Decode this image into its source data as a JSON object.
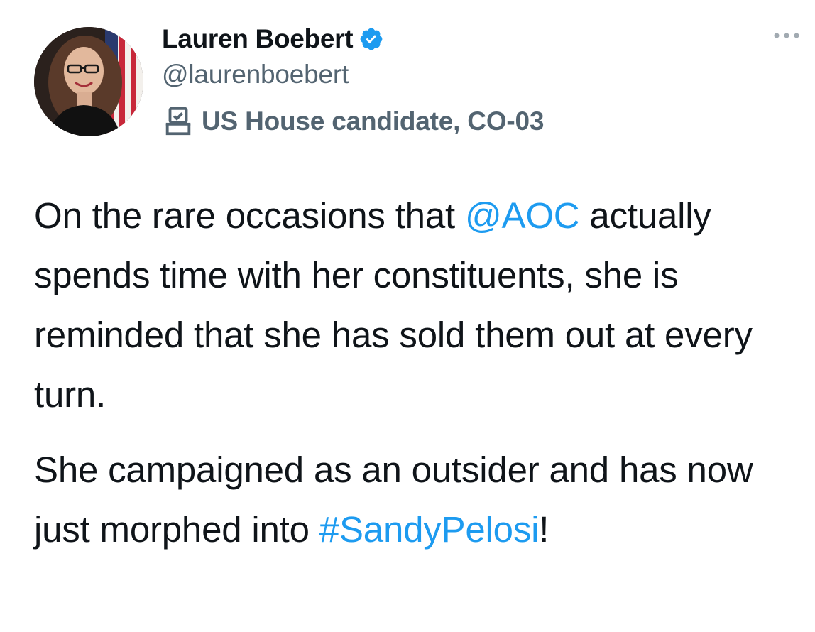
{
  "author": {
    "display_name": "Lauren Boebert",
    "handle": "@laurenboebert",
    "label": "US House candidate, CO-03",
    "verified_icon": "verified-badge-icon",
    "label_icon": "ballot-box-icon"
  },
  "tweet": {
    "paragraph1": {
      "before_mention": "On the rare occasions that ",
      "mention": "@AOC",
      "after_mention": " actually spends time with her constituents, she is reminded that she has sold them out at every turn."
    },
    "paragraph2": {
      "text": "She campaigned as an outsider and has now just morphed into ",
      "hashtag": "#SandyPelosi",
      "after_hashtag": "!"
    }
  },
  "menu": {
    "more_icon": "more-dots-icon"
  },
  "colors": {
    "link": "#1d9bf0",
    "text": "#0f1419",
    "secondary": "#536471",
    "verified": "#1d9bf0"
  }
}
